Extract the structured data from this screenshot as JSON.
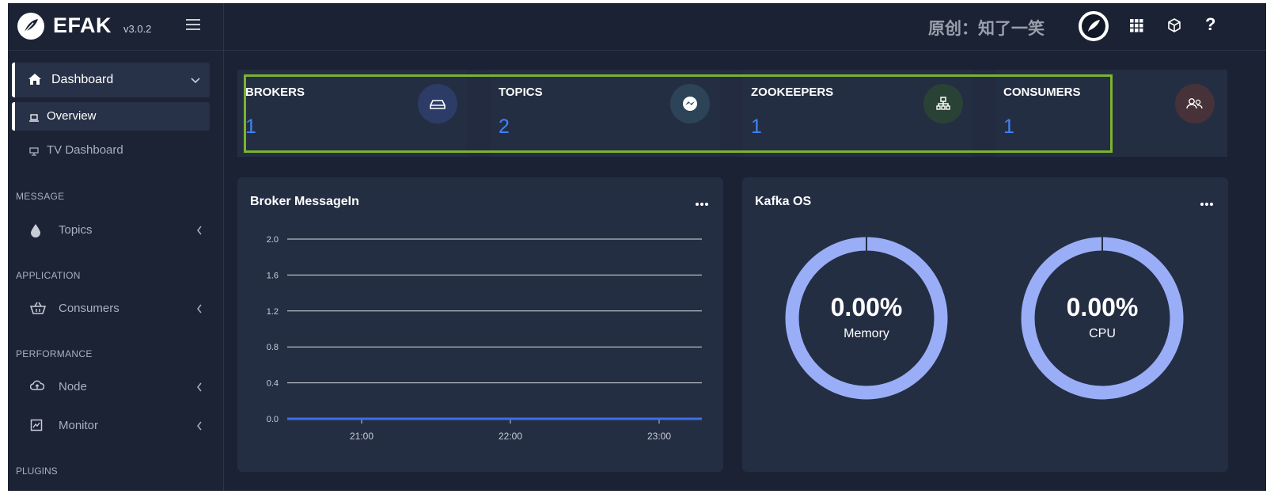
{
  "brand": {
    "name": "EFAK",
    "version": "v3.0.2"
  },
  "topbar": {
    "author_text": "原创：知了一笑",
    "help": "?"
  },
  "sidebar": {
    "dashboard": "Dashboard",
    "overview": "Overview",
    "tv_dashboard": "TV Dashboard",
    "sections": {
      "message": "MESSAGE",
      "application": "APPLICATION",
      "performance": "PERFORMANCE",
      "plugins": "PLUGINS"
    },
    "items": {
      "topics": "Topics",
      "consumers": "Consumers",
      "node": "Node",
      "monitor": "Monitor"
    }
  },
  "stats": [
    {
      "title": "BROKERS",
      "value": "1",
      "icon": "drive-icon",
      "icon_bg": "#2c3c66"
    },
    {
      "title": "TOPICS",
      "value": "2",
      "icon": "messenger-icon",
      "icon_bg": "#2c4358"
    },
    {
      "title": "ZOOKEEPERS",
      "value": "1",
      "icon": "sitemap-icon",
      "icon_bg": "#2a4235"
    },
    {
      "title": "CONSUMERS",
      "value": "1",
      "icon": "users-icon",
      "icon_bg": "#463238"
    }
  ],
  "broker_panel": {
    "title": "Broker MessageIn"
  },
  "kafka_panel": {
    "title": "Kafka OS",
    "memory": {
      "value": "0.00%",
      "label": "Memory"
    },
    "cpu": {
      "value": "0.00%",
      "label": "CPU"
    }
  },
  "colors": {
    "accent": "#3f83f8",
    "ring": "#9aaef7",
    "highlight": "#7bb32e"
  },
  "chart_data": {
    "type": "line",
    "title": "Broker MessageIn",
    "x_ticks": [
      "21:00",
      "22:00",
      "23:00"
    ],
    "y_ticks": [
      "2.0",
      "1.6",
      "1.2",
      "0.8",
      "0.4",
      "0.0"
    ],
    "ylim": [
      0,
      2.0
    ],
    "grid": true,
    "series": [
      {
        "values": [
          0,
          0,
          0,
          0,
          0,
          0,
          0
        ],
        "color": "#3f6ee8"
      }
    ]
  }
}
